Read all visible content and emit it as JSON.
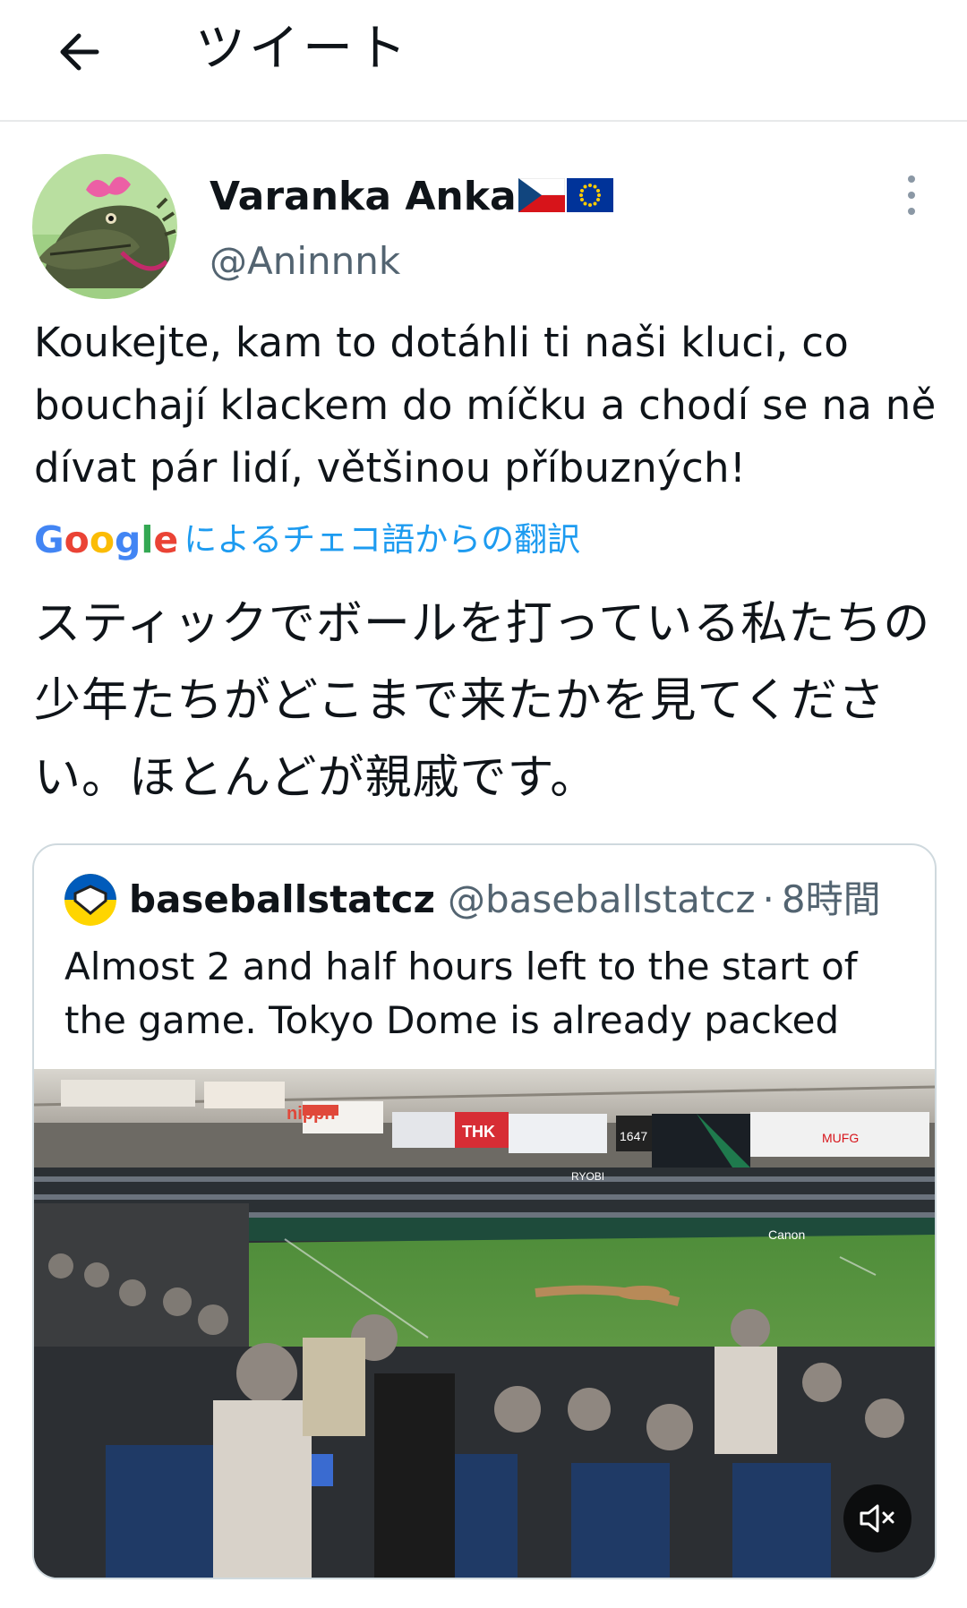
{
  "header": {
    "title": "ツイート"
  },
  "tweet": {
    "author": {
      "display_name": "Varanka Anka",
      "handle": "@Aninnnk"
    },
    "text": "Koukejte, kam to dotáhli ti naši kluci, co bouchají klackem do míčku a chodí se na ně dívat pár lidí, většinou příbuzných!",
    "translation": {
      "provider": "Google",
      "label": "によるチェコ語からの翻訳",
      "text": "スティックでボールを打っている私たちの少年たちがどこまで来たかを見てください。ほとんどが親戚です。"
    },
    "quote": {
      "display_name": "baseballstatcz",
      "handle": "@baseballstatcz",
      "separator": "·",
      "time": "8時間",
      "text": "Almost 2 and half hours left to the start of the game. Tokyo Dome is already packed",
      "media_signage": [
        "nippn",
        "THK",
        "Canon",
        "MUFG",
        "RYOBI",
        "1647"
      ]
    }
  },
  "colors": {
    "link": "#1d9bf0",
    "secondary_text": "#536471",
    "border": "#cfd9de"
  }
}
